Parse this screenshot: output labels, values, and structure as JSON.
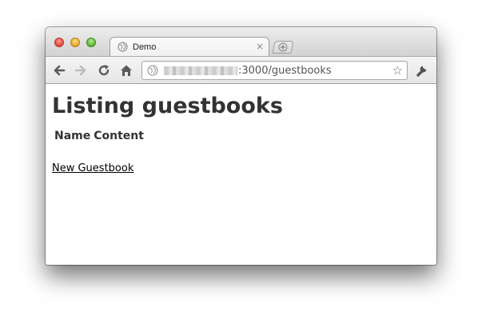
{
  "browser": {
    "tab": {
      "title": "Demo",
      "close_glyph": "×",
      "favicon": "globe-icon"
    },
    "toolbar": {
      "back_icon": "back-arrow-icon",
      "forward_icon": "forward-arrow-icon",
      "reload_icon": "reload-icon",
      "home_icon": "home-icon",
      "address_path": ":3000/guestbooks",
      "bookmark_icon": "star-icon",
      "menu_icon": "wrench-icon"
    }
  },
  "page": {
    "title": "Listing guestbooks",
    "table": {
      "headers": [
        "Name",
        "Content"
      ]
    },
    "new_link": "New Guestbook"
  }
}
